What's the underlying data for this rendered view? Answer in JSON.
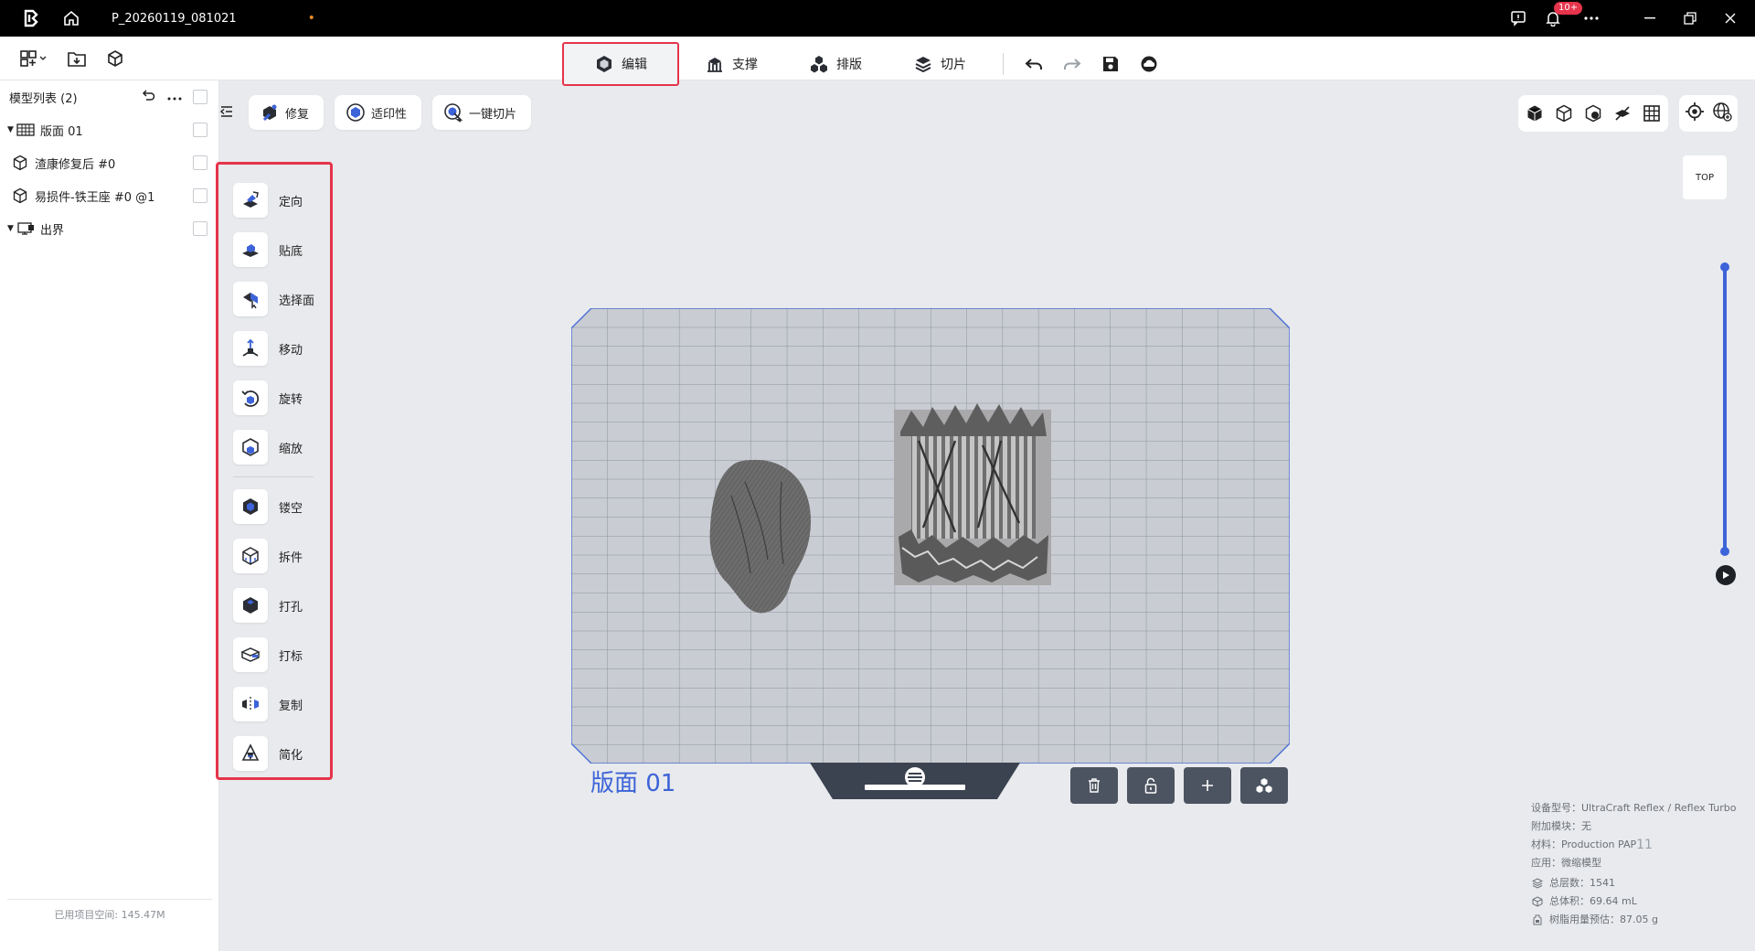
{
  "titlebar": {
    "project_name": "P_20260119_081021",
    "unsaved_dot": "•",
    "notification_badge": "10+"
  },
  "toolbar": {
    "tabs": [
      {
        "label": "编辑",
        "icon": "edit-cube-icon"
      },
      {
        "label": "支撑",
        "icon": "support-icon"
      },
      {
        "label": "排版",
        "icon": "layout-icon"
      },
      {
        "label": "切片",
        "icon": "slice-icon"
      }
    ]
  },
  "model_list": {
    "title": "模型列表 (2)",
    "items": [
      {
        "label": "版面 01",
        "icon": "plate-grid-icon",
        "expandable": true
      },
      {
        "label": "渣康修复后 #0",
        "icon": "model-cube-icon",
        "expandable": false
      },
      {
        "label": "易损件-铁王座 #0 @1",
        "icon": "model-cube-icon",
        "expandable": false
      },
      {
        "label": "出界",
        "icon": "out-of-bounds-icon",
        "expandable": true
      }
    ],
    "storage_text": "已用项目空间: 145.47M"
  },
  "action_pills": [
    {
      "label": "修复",
      "icon": "repair-icon"
    },
    {
      "label": "适印性",
      "icon": "printability-icon"
    },
    {
      "label": "一键切片",
      "icon": "one-click-slice-icon"
    }
  ],
  "tools_group1": [
    {
      "label": "定向",
      "icon": "orient-icon"
    },
    {
      "label": "贴底",
      "icon": "lay-flat-icon"
    },
    {
      "label": "选择面",
      "icon": "select-face-icon"
    },
    {
      "label": "移动",
      "icon": "move-icon"
    },
    {
      "label": "旋转",
      "icon": "rotate-icon"
    },
    {
      "label": "缩放",
      "icon": "scale-icon"
    }
  ],
  "tools_group2": [
    {
      "label": "镂空",
      "icon": "hollow-icon"
    },
    {
      "label": "拆件",
      "icon": "split-icon"
    },
    {
      "label": "打孔",
      "icon": "drill-hole-icon"
    },
    {
      "label": "打标",
      "icon": "label-icon"
    },
    {
      "label": "复制",
      "icon": "duplicate-icon"
    },
    {
      "label": "简化",
      "icon": "simplify-icon"
    }
  ],
  "viewport": {
    "top_view_label": "TOP",
    "plate_label": "版面 01",
    "layer_slider": {
      "top_fraction": 1.0,
      "bottom_fraction": 0.0
    }
  },
  "info": {
    "device": "设备型号：UltraCraft Reflex / Reflex Turbo",
    "module": "附加模块：无",
    "material": "材料：Production PAP",
    "material_suffix": "11",
    "application": "应用：微缩模型",
    "layers": "总层数：1541",
    "volume": "总体积：69.64 mL",
    "resin": "树脂用量预估：87.05 g"
  },
  "colors": {
    "accent_blue": "#3c63d8",
    "highlight_red": "#e5344b",
    "titlebar_bg": "#000000",
    "canvas_bg": "#e8eaed"
  }
}
